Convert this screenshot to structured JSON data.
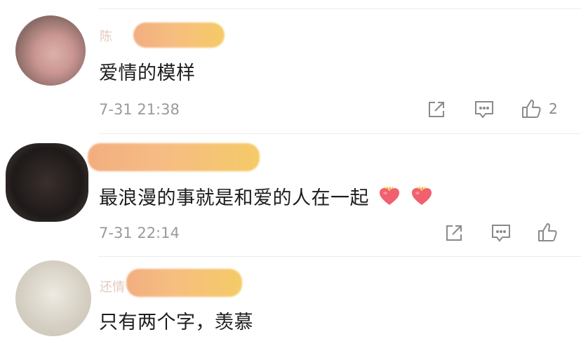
{
  "comments": [
    {
      "name": "陈",
      "text": "爱情的模样",
      "time": "7-31 21:38",
      "likes": "2",
      "emojis": []
    },
    {
      "name": "",
      "text": "最浪漫的事就是和爱的人在一起",
      "time": "7-31 22:14",
      "likes": "",
      "emojis": [
        "heart-with-crown-emoji",
        "heart-with-crown-emoji"
      ]
    },
    {
      "name": "还情",
      "text": "只有两个字，羡慕",
      "time": "",
      "likes": "",
      "emojis": []
    }
  ],
  "icons": {
    "share": "share-icon",
    "reply": "comment-reply-icon",
    "like": "thumbs-up-icon"
  },
  "colors": {
    "text": "#1d1d1d",
    "meta": "#9a9a9a",
    "icon": "#8a8a8a",
    "divider": "#ececec",
    "redaction_orange": "#f0a060",
    "redaction_yellow": "#f5c84a"
  }
}
